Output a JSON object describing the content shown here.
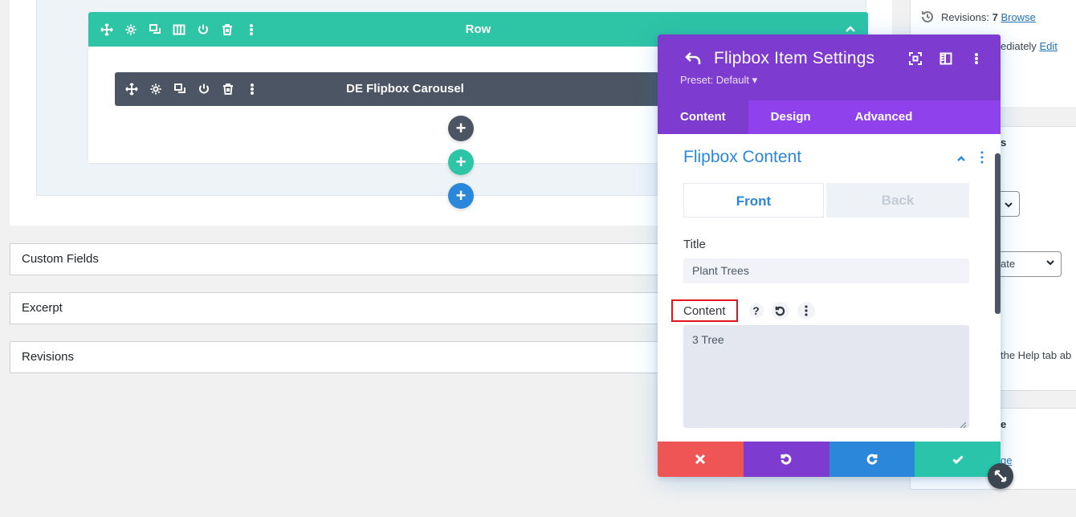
{
  "builder": {
    "row": {
      "title": "Row"
    },
    "module": {
      "title": "DE Flipbox Carousel"
    },
    "add_buttons": [
      "+",
      "+",
      "+"
    ]
  },
  "metaboxes": {
    "custom_fields": "Custom Fields",
    "excerpt": "Excerpt",
    "revisions": "Revisions"
  },
  "wp_sidebar": {
    "revisions_label": "Revisions:",
    "revisions_count": "7",
    "browse_link": "Browse",
    "immediately_text": "ediately",
    "edit_link": "Edit",
    "box_heading_fragment": "s",
    "select_value_fragment": "ate",
    "help_text_fragment": "the Help tab ab",
    "box3_heading_fragment": "e",
    "box3_link_fragment": "ge"
  },
  "modal": {
    "title": "Flipbox Item Settings",
    "preset": "Preset: Default ▾",
    "tabs": [
      "Content",
      "Design",
      "Advanced"
    ],
    "section_title": "Flipbox Content",
    "segments": {
      "front": "Front",
      "back": "Back"
    },
    "title_label": "Title",
    "title_value": "Plant Trees",
    "content_label": "Content",
    "help_symbol": "?",
    "content_value": "3 Tree"
  },
  "colors": {
    "row_accent": "#2ec4a6",
    "module_bar": "#4b5563",
    "modal_header": "#7e3bd0",
    "modal_tabs": "#8f42ec",
    "section_title": "#2b87da",
    "cancel": "#ef5555",
    "undo": "#7e3bd0",
    "redo": "#2b87da",
    "save": "#29c4a9",
    "highlight_box": "#e1141f"
  }
}
